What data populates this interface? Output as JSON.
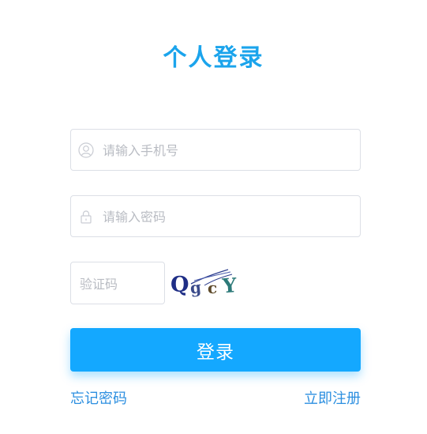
{
  "title": "个人登录",
  "phone": {
    "placeholder": "请输入手机号",
    "icon": "user-icon"
  },
  "password": {
    "placeholder": "请输入密码",
    "icon": "lock-icon"
  },
  "captcha": {
    "placeholder": "验证码",
    "code": "QgcY"
  },
  "login_label": "登录",
  "links": {
    "forgot": "忘记密码",
    "register": "立即注册"
  },
  "colors": {
    "title": "#1ba4ec",
    "button": "#14a8ff",
    "link": "#2c8fe0",
    "placeholder": "#b9bcc3"
  }
}
